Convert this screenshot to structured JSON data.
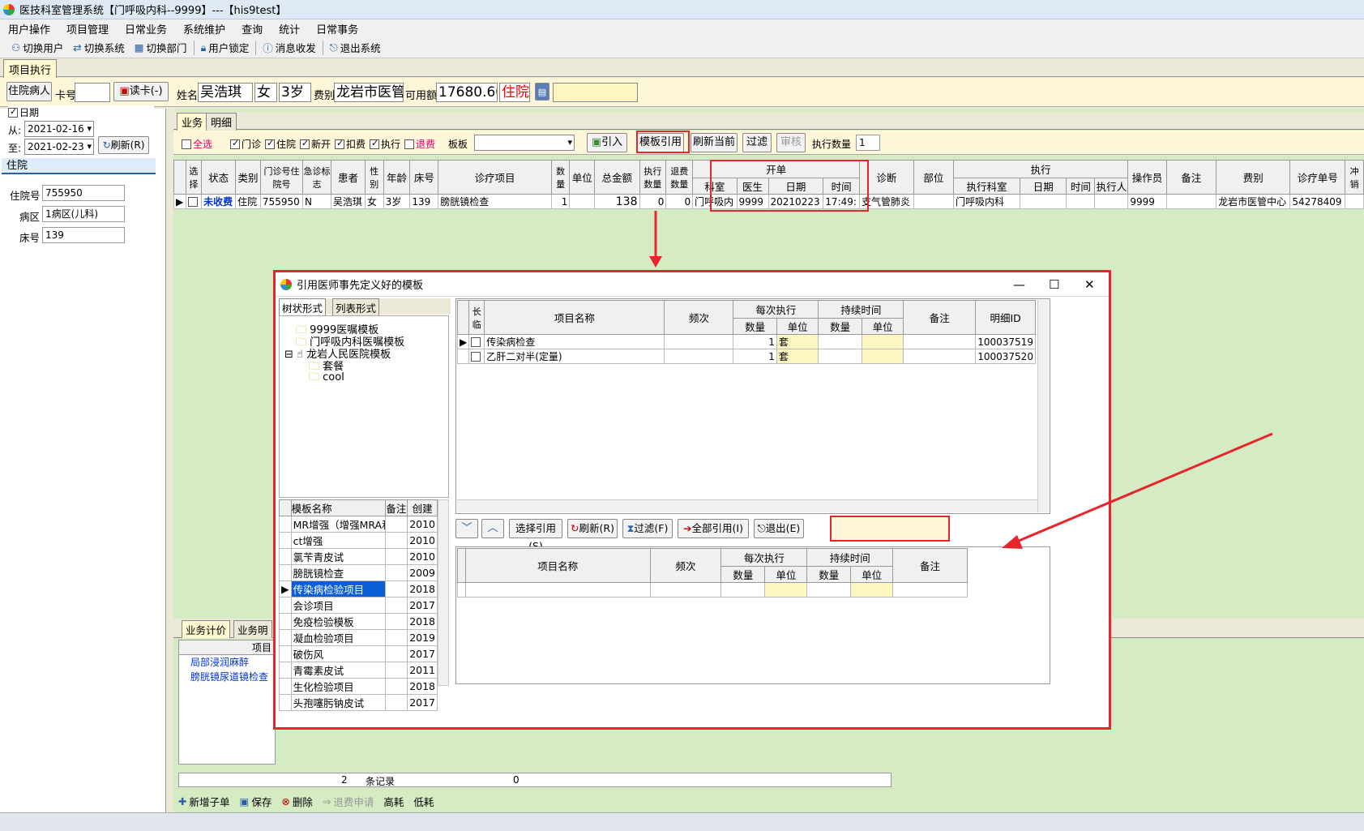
{
  "window": {
    "title": "医技科室管理系统【门呼吸内科--9999】---【his9test】"
  },
  "menu": [
    "用户操作",
    "项目管理",
    "日常业务",
    "系统维护",
    "查询",
    "统计",
    "日常事务"
  ],
  "toolbar": {
    "switch_user": "切换用户",
    "switch_system": "切换系统",
    "switch_dept": "切换部门",
    "lock_user": "用户锁定",
    "messages": "消息收发",
    "exit": "退出系统"
  },
  "main_tab": "项目执行",
  "patient": {
    "type": "住院病人",
    "card_label": "卡号",
    "read_card": "读卡(-)",
    "name_label": "姓名",
    "name": "吴浩琪",
    "sex": "女",
    "age": "3岁",
    "fee_label": "费别",
    "fee_type": "龙岩市医管",
    "balance_label": "可用额",
    "balance": "17680.60",
    "status": "住院"
  },
  "left": {
    "date_label": "日期",
    "from_label": "从:",
    "from": "2021-02-16",
    "to_label": "至:",
    "to": "2021-02-23",
    "refresh": "刷新(R)",
    "section": "住院",
    "admission_label": "住院号",
    "admission": "755950",
    "ward_label": "病区",
    "ward": "1病区(儿科)",
    "bed_label": "床号",
    "bed": "139"
  },
  "tabs": {
    "business": "业务",
    "detail": "明细"
  },
  "filters": {
    "select_all": "全选",
    "outpatient": "门诊",
    "inpatient": "住院",
    "new": "新开",
    "charge": "扣费",
    "execute": "执行",
    "refund": "退费",
    "template_label": "板板",
    "import": "引入",
    "template_ref": "模板引用",
    "refresh_current": "刷新当前",
    "filter": "过滤",
    "audit": "审核",
    "exec_count_label": "执行数量",
    "exec_count": "1"
  },
  "grid": {
    "headers": {
      "select": "选择",
      "state": "状态",
      "category": "类别",
      "clinic_no": "门诊号住院号",
      "urgent": "急诊标志",
      "patient": "患者",
      "sex": "性别",
      "age": "年龄",
      "bed": "床号",
      "item": "诊疗项目",
      "qty": "数量",
      "unit": "单位",
      "total": "总金额",
      "exec_qty": "执行数量",
      "refund_qty": "退费数量",
      "order_group": "开单",
      "order_dept": "科室",
      "order_doc": "医生",
      "order_date": "日期",
      "order_time": "时间",
      "diagnosis": "诊断",
      "site": "部位",
      "exec_group": "执行",
      "exec_dept": "执行科室",
      "exec_date": "日期",
      "exec_time": "时间",
      "executor": "执行人",
      "operator": "操作员",
      "remark": "备注",
      "fee_type": "费别",
      "order_no": "诊疗单号",
      "offset": "冲销"
    },
    "row": {
      "state": "未收费",
      "category": "住院",
      "clinic_no": "755950",
      "urgent": "N",
      "patient": "吴浩琪",
      "sex": "女",
      "age": "3岁",
      "bed": "139",
      "item": "膀胱镜检查",
      "qty": "1",
      "total": "138",
      "exec_qty": "0",
      "refund_qty": "0",
      "order_dept": "门呼吸内",
      "order_doc": "9999",
      "order_date": "20210223",
      "order_time": "17:49:",
      "diagnosis": "支气管肺炎",
      "exec_dept": "门呼吸内科",
      "operator": "9999",
      "fee_type": "龙岩市医管中心",
      "order_no": "54278409"
    }
  },
  "lower": {
    "tab1": "业务计价",
    "tab2": "业务明",
    "col": "项目",
    "rows": [
      "局部浸润麻醉",
      "膀胱镜尿道镜检查"
    ]
  },
  "footer": {
    "count": "2",
    "records": "条记录",
    "zero": "0",
    "new_sub": "新增子单",
    "save": "保存",
    "delete": "删除",
    "refund_apply": "退费申请",
    "high": "高耗",
    "low": "低耗"
  },
  "dialog": {
    "title": "引用医师事先定义好的模板",
    "tree_tab": "树状形式",
    "list_tab": "列表形式",
    "tree": [
      "9999医嘱模板",
      "门呼吸内科医嘱模板",
      "龙岩人民医院模板",
      "套餐",
      "cool"
    ],
    "tmpl_headers": {
      "name": "模板名称",
      "remark": "备注",
      "created": "创建"
    },
    "templates": [
      [
        "MR增强（增强MRA和)",
        "2010"
      ],
      [
        "ct增强",
        "2010"
      ],
      [
        "氯苄青皮试",
        "2010"
      ],
      [
        "膀胱镜检查",
        "2009"
      ],
      [
        "传染病检验项目",
        "2018"
      ],
      [
        "会诊项目",
        "2017"
      ],
      [
        "免疫检验模板",
        "2018"
      ],
      [
        "凝血检验项目",
        "2019"
      ],
      [
        "破伤风",
        "2017"
      ],
      [
        "青霉素皮试",
        "2011"
      ],
      [
        "生化检验项目",
        "2018"
      ],
      [
        "头孢噻肟钠皮试",
        "2017"
      ]
    ],
    "item_headers": {
      "long": "长临",
      "name": "项目名称",
      "freq": "频次",
      "each": "每次执行",
      "qty": "数量",
      "unit": "单位",
      "duration": "持续时间",
      "dqty": "数量",
      "dunit": "单位",
      "remark": "备注",
      "detail_id": "明细ID"
    },
    "items": [
      {
        "name": "传染病检查",
        "qty": "1",
        "unit": "套",
        "id": "100037519"
      },
      {
        "name": "乙肝二对半(定量)",
        "qty": "1",
        "unit": "套",
        "id": "100037520"
      }
    ],
    "buttons": {
      "select_ref": "选择引用(S)",
      "refresh": "刷新(R)",
      "filter": "过滤(F)",
      "all_ref": "全部引用(I)",
      "exit": "退出(E)"
    }
  }
}
